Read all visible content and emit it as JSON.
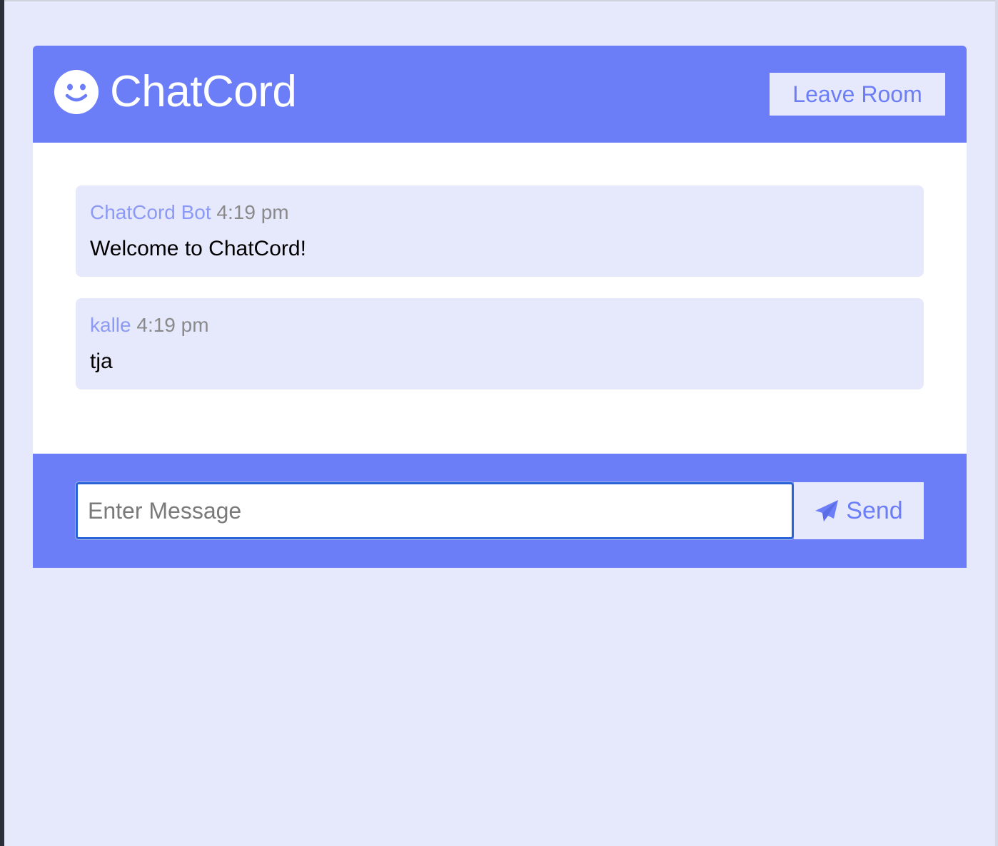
{
  "header": {
    "title": "ChatCord",
    "leave_label": "Leave Room"
  },
  "messages": [
    {
      "user": "ChatCord Bot",
      "time": "4:19 pm",
      "text": "Welcome to ChatCord!"
    },
    {
      "user": "kalle",
      "time": "4:19 pm",
      "text": "tja"
    }
  ],
  "form": {
    "placeholder": "Enter Message",
    "send_label": "Send"
  },
  "colors": {
    "accent": "#6b7ef8",
    "light_bg": "#e6e8fb",
    "username": "#8c9af6",
    "timestamp": "#8a8a8a"
  },
  "icons": {
    "brand": "smile-icon",
    "send": "paper-plane-icon"
  }
}
